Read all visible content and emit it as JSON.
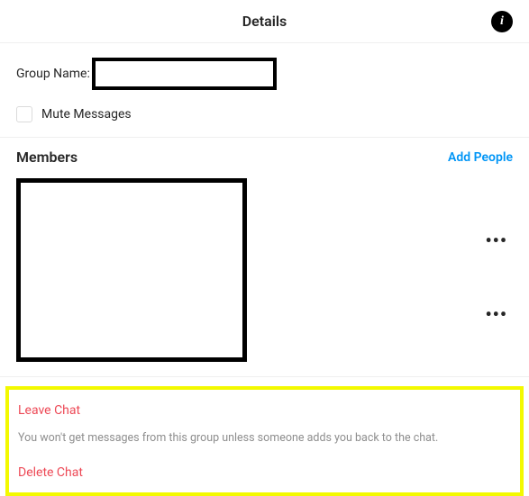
{
  "header": {
    "title": "Details",
    "info_glyph": "i"
  },
  "group": {
    "label": "Group Name:",
    "value": ""
  },
  "mute": {
    "label": "Mute Messages",
    "checked": false
  },
  "members": {
    "title": "Members",
    "add_label": "Add People",
    "item_actions_glyph": "•••"
  },
  "danger": {
    "leave_label": "Leave Chat",
    "leave_note": "You won't get messages from this group unless someone adds you back to the chat.",
    "delete_label": "Delete Chat"
  }
}
